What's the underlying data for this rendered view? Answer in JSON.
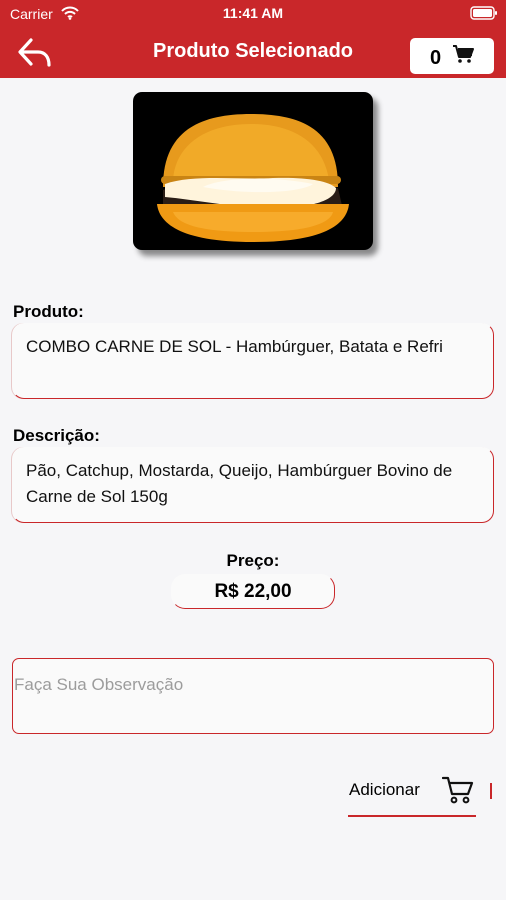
{
  "status_bar": {
    "carrier": "Carrier",
    "time": "11:41 AM"
  },
  "header": {
    "title": "Produto Selecionado",
    "cart_count": "0",
    "background_color": "#c9272a"
  },
  "product": {
    "image_icon": "burger-photo",
    "name_label": "Produto:",
    "name_value": "COMBO CARNE DE SOL - Hambúrguer, Batata e Refri",
    "description_label": "Descrição:",
    "description_value": "Pão, Catchup, Mostarda, Queijo, Hambúrguer Bovino de Carne de Sol 150g",
    "price_label": "Preço:",
    "price_value": "R$ 22,00"
  },
  "observation": {
    "placeholder": "Faça Sua Observação",
    "value": ""
  },
  "actions": {
    "add_label": "Adicionar"
  },
  "colors": {
    "accent": "#c9272a",
    "background": "#f6f6f8"
  }
}
